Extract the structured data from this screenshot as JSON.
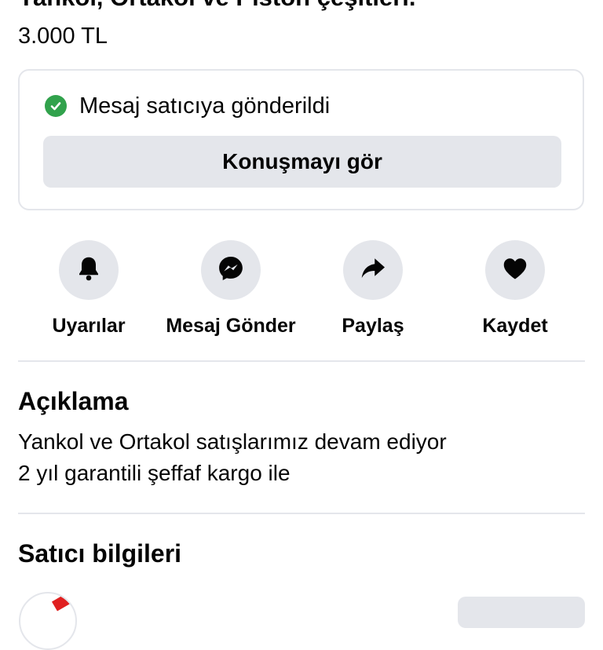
{
  "listing": {
    "title": "Yankol, Ortakol ve Piston çeşitleri.",
    "price": "3.000 TL"
  },
  "message_card": {
    "status_text": "Mesaj satıcıya gönderildi",
    "button_label": "Konuşmayı gör"
  },
  "actions": [
    {
      "label": "Uyarılar",
      "icon": "bell-icon"
    },
    {
      "label": "Mesaj Gönder",
      "icon": "messenger-icon"
    },
    {
      "label": "Paylaş",
      "icon": "share-icon"
    },
    {
      "label": "Kaydet",
      "icon": "heart-icon"
    }
  ],
  "description": {
    "heading": "Açıklama",
    "line1": "Yankol ve Ortakol satışlarımız devam ediyor",
    "line2": "2 yıl garantili şeffaf kargo ile"
  },
  "seller": {
    "heading": "Satıcı bilgileri"
  },
  "colors": {
    "success": "#31a24c",
    "button_bg": "#e4e6eb",
    "text": "#050505"
  }
}
